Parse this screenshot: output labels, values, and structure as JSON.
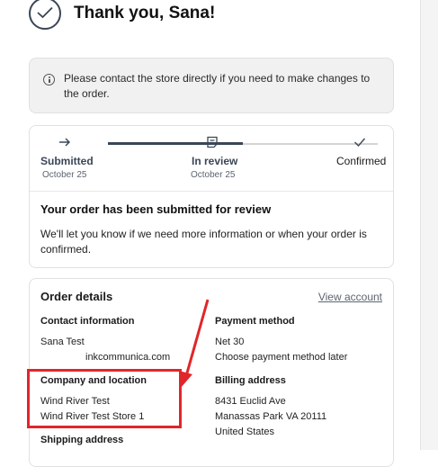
{
  "header": {
    "title": "Thank you, Sana!"
  },
  "notice": {
    "text": "Please contact the store directly if you need to make changes to the order."
  },
  "progress": {
    "steps": [
      {
        "label": "Submitted",
        "date": "October 25"
      },
      {
        "label": "In review",
        "date": "October 25"
      },
      {
        "label": "Confirmed",
        "date": ""
      }
    ],
    "completed_fraction": 0.5
  },
  "review": {
    "title": "Your order has been submitted for review",
    "text": "We'll let you know if we need more information or when your order is confirmed."
  },
  "details": {
    "title": "Order details",
    "view_account": "View account",
    "contact": {
      "heading": "Contact information",
      "name": "Sana Test",
      "email": "inkcommunica.com"
    },
    "payment": {
      "heading": "Payment method",
      "terms": "Net 30",
      "note": "Choose payment method later"
    },
    "company": {
      "heading": "Company and location",
      "company": "Wind River Test",
      "location": "Wind River Test Store 1"
    },
    "billing": {
      "heading": "Billing address",
      "line1": "8431 Euclid Ave",
      "line2": "Manassas Park VA 20111",
      "line3": "United States"
    },
    "shipping": {
      "heading": "Shipping address"
    }
  },
  "colors": {
    "annotation": "#e0262a",
    "accent": "#3a4656"
  }
}
